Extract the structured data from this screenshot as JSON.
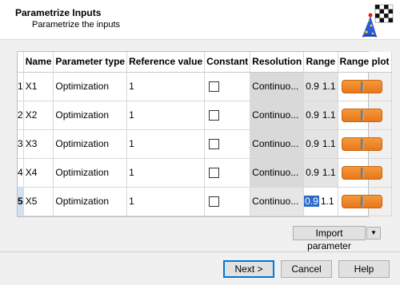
{
  "header": {
    "title": "Parametrize Inputs",
    "subtitle": "Parametrize the inputs",
    "logo_icon": "wizard-hat-checkered-flag-icon"
  },
  "table": {
    "columns": [
      "Name",
      "Parameter type",
      "Reference value",
      "Constant",
      "Resolution",
      "Range",
      "Range plot"
    ],
    "rows": [
      {
        "num": "1",
        "name": "X1",
        "type": "Optimization",
        "ref": "1",
        "constant": false,
        "resolution": "Continuo...",
        "range_min": "0.9",
        "range_max": "1.1"
      },
      {
        "num": "2",
        "name": "X2",
        "type": "Optimization",
        "ref": "1",
        "constant": false,
        "resolution": "Continuo...",
        "range_min": "0.9",
        "range_max": "1.1"
      },
      {
        "num": "3",
        "name": "X3",
        "type": "Optimization",
        "ref": "1",
        "constant": false,
        "resolution": "Continuo...",
        "range_min": "0.9",
        "range_max": "1.1"
      },
      {
        "num": "4",
        "name": "X4",
        "type": "Optimization",
        "ref": "1",
        "constant": false,
        "resolution": "Continuo...",
        "range_min": "0.9",
        "range_max": "1.1"
      },
      {
        "num": "5",
        "name": "X5",
        "type": "Optimization",
        "ref": "1",
        "constant": false,
        "resolution": "Continuo...",
        "range_min": "0.9",
        "range_max": "1.1",
        "current": true,
        "range_min_selected": true
      }
    ]
  },
  "import_button": {
    "label": "Import parameter",
    "dropdown_icon": "triangle-down-icon"
  },
  "footer": {
    "next_label": "Next >",
    "cancel_label": "Cancel",
    "help_label": "Help"
  },
  "colors": {
    "range_bar": "#ee8125",
    "selection": "#2a6ac9",
    "current_row": "#cfe3f5",
    "resolution_cell": "#d9d9d9"
  }
}
